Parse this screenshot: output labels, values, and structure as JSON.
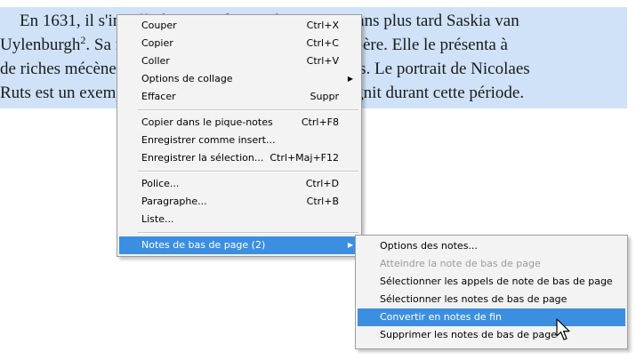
{
  "document": {
    "lines": [
      "En 1631, il s'installa à Amsterdam et épousa trois ans plus tard Saskia van",
      "Uylenburgh",
      ". Sa famille était un négociant d'art prospère. Elle le présenta à",
      "de riches mécènes pour lesquels il réalisa des portraits. Le portrait de Nicolaes",
      "Ruts est un exemple des nombreux portraits qu'il peignit durant cette période."
    ],
    "footnote_ref": "2"
  },
  "context_menu": {
    "items": [
      {
        "label": "Couper",
        "shortcut": "Ctrl+X"
      },
      {
        "label": "Copier",
        "shortcut": "Ctrl+C"
      },
      {
        "label": "Coller",
        "shortcut": "Ctrl+V"
      },
      {
        "label": "Options de collage",
        "shortcut": ""
      },
      {
        "label": "Effacer",
        "shortcut": "Suppr"
      },
      {
        "label": "Copier dans le pique-notes",
        "shortcut": "Ctrl+F8"
      },
      {
        "label": "Enregistrer comme insert...",
        "shortcut": ""
      },
      {
        "label": "Enregistrer la sélection...",
        "shortcut": "Ctrl+Maj+F12"
      },
      {
        "label": "Police...",
        "shortcut": "Ctrl+D"
      },
      {
        "label": "Paragraphe...",
        "shortcut": "Ctrl+B"
      },
      {
        "label": "Liste...",
        "shortcut": ""
      },
      {
        "label": "Notes de bas de page (2)",
        "shortcut": ""
      }
    ],
    "submenu_arrow": "▶"
  },
  "submenu": {
    "items": [
      {
        "label": "Options des notes...",
        "disabled": false
      },
      {
        "label": "Atteindre la note de bas de page",
        "disabled": true
      },
      {
        "label": "Sélectionner les appels de note de bas de page",
        "disabled": false
      },
      {
        "label": "Sélectionner les notes de bas de page",
        "disabled": false
      },
      {
        "label": "Convertir en notes de fin",
        "disabled": false
      },
      {
        "label": "Supprimer les notes de bas de page",
        "disabled": false
      }
    ]
  },
  "colors": {
    "selection": "#cfe2f7",
    "highlight": "#3c8fe0",
    "menu_bg": "#f3f3f3",
    "disabled_text": "#9a9a9a"
  }
}
